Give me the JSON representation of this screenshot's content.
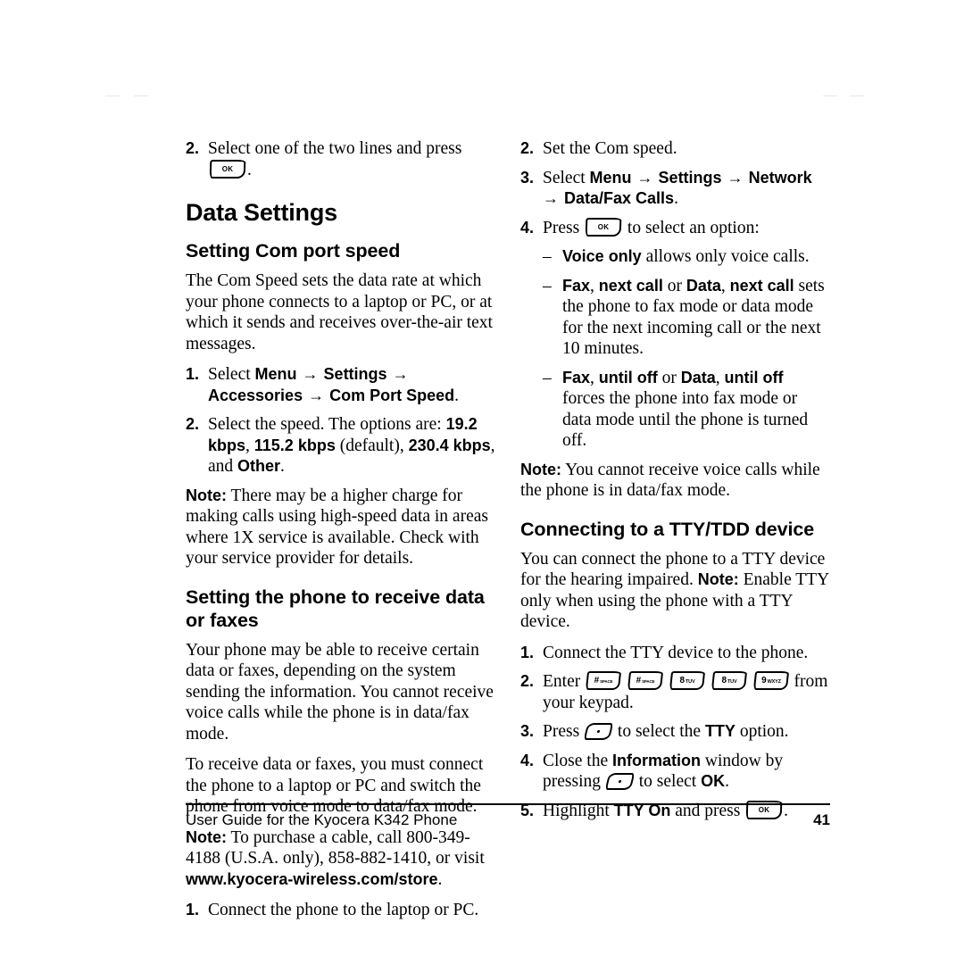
{
  "document": {
    "title": "User Guide for the Kyocera K342 Phone",
    "page_number": "41"
  },
  "left_column": {
    "carryover_step": {
      "marker": "2.",
      "text_before": "Select one of the two lines and press",
      "key": "ok-key",
      "text_after": "."
    },
    "section_title": "Data Settings",
    "subsection_1": {
      "title": "Setting Com port speed",
      "intro": "The Com Speed sets the data rate at which your phone connects to a laptop or PC, or at which it sends and receives over-the-air text messages.",
      "steps": [
        {
          "marker": "1.",
          "parts": [
            "Select ",
            "Menu",
            " → ",
            "Settings",
            " → ",
            "Accessories",
            " → ",
            "Com Port Speed",
            "."
          ]
        },
        {
          "marker": "2.",
          "parts": [
            "Select the speed. The options are: ",
            "19.2 kbps",
            ", ",
            "115.2 kbps",
            " (default), ",
            "230.4 kbps",
            ", and ",
            "Other",
            "."
          ]
        }
      ],
      "note_label": "Note:",
      "note_text": "There may be a higher charge for making calls using high-speed data in areas where 1X service is available. Check with your service provider for details."
    },
    "subsection_2": {
      "title": "Setting the phone to receive data or faxes",
      "para_1": "Your phone may be able to receive certain data or faxes, depending on the system sending the information. You cannot receive voice calls while the phone is in data/fax mode.",
      "para_2": "To receive data or faxes, you must connect the phone to a laptop or PC and switch the phone from voice mode to data/fax mode.",
      "note_label": "Note:",
      "note_text_before": "To purchase a cable, call 800-349-4188 (U.S.A. only), 858-882-1410, or visit",
      "note_url": "www.kyocera-wireless.com/store",
      "note_text_after": ".",
      "step": {
        "marker": "1.",
        "text": "Connect the phone to the laptop or PC."
      }
    }
  },
  "right_column": {
    "steps_continued": [
      {
        "marker": "2.",
        "text": "Set the Com speed."
      },
      {
        "marker": "3.",
        "parts": [
          "Select ",
          "Menu",
          " → ",
          "Settings",
          " → ",
          "Network",
          " → ",
          "Data/Fax Calls",
          "."
        ]
      },
      {
        "marker": "4.",
        "text_before": "Press",
        "key": "ok-key",
        "text_after": "to select an option:"
      }
    ],
    "options": [
      {
        "marker": "–",
        "bold_1": "Voice only",
        "rest": " allows only voice calls."
      },
      {
        "marker": "–",
        "bold_1": "Fax",
        "sep_1": ", ",
        "bold_2": "next call",
        "sep_2": " or ",
        "bold_3": "Data",
        "sep_3": ", ",
        "bold_4": "next call",
        "rest": " sets the phone to fax mode or data mode for the next incoming call or the next 10 minutes."
      },
      {
        "marker": "–",
        "bold_1": "Fax",
        "sep_1": ", ",
        "bold_2": "until off",
        "sep_2": " or ",
        "bold_3": "Data",
        "sep_3": ", ",
        "bold_4": "until off",
        "rest": " forces the phone into fax mode or data mode until the phone is turned off."
      }
    ],
    "note_label": "Note:",
    "note_text": "You cannot receive voice calls while the phone is in data/fax mode.",
    "tty_section": {
      "title": "Connecting to a TTY/TDD device",
      "intro_before": "You can connect the phone to a TTY device for the hearing impaired. ",
      "intro_note_label": "Note:",
      "intro_after": " Enable TTY only when using the phone with a TTY device.",
      "steps": [
        {
          "marker": "1.",
          "text": "Connect the TTY device to the phone."
        },
        {
          "marker": "2.",
          "text_before": "Enter",
          "keys": [
            "hash-key",
            "hash-key",
            "8-tuv-key",
            "8-tuv-key",
            "9-wxyz-key"
          ],
          "text_after": "from your keypad."
        },
        {
          "marker": "3.",
          "text_before": "Press",
          "key": "nav-select-key",
          "text_mid": "to select the ",
          "bold": "TTY",
          "text_after": " option."
        },
        {
          "marker": "4.",
          "text_before": "Close the ",
          "bold_1": "Information",
          "text_mid": " window by pressing",
          "key": "nav-select-key",
          "text_after": "to select ",
          "bold_2": "OK",
          "text_end": "."
        },
        {
          "marker": "5.",
          "text_before": "Highlight ",
          "bold": "TTY On",
          "text_mid": " and press",
          "key": "ok-key",
          "text_after": "."
        }
      ]
    }
  },
  "keys": {
    "ok": {
      "label": "OK"
    },
    "hash": {
      "digit": "#",
      "letters": "SPACE"
    },
    "eight": {
      "digit": "8",
      "letters": "TUV"
    },
    "nine": {
      "digit": "9",
      "letters": "WXYZ"
    }
  }
}
